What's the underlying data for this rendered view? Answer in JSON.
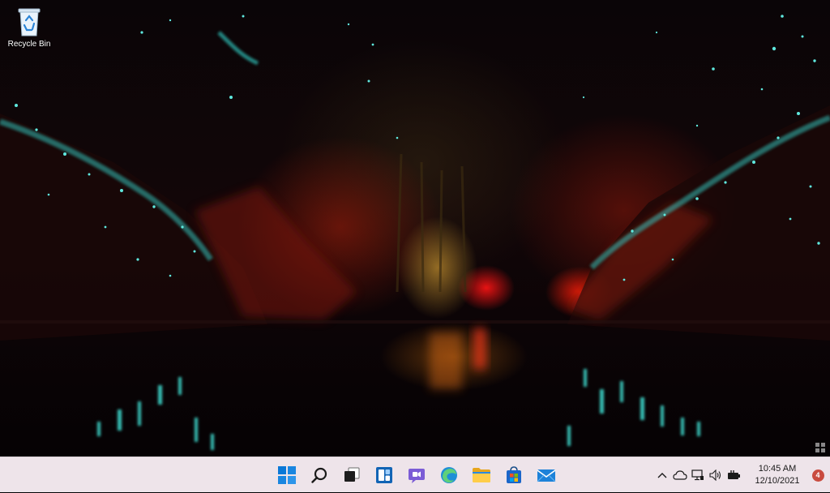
{
  "desktop": {
    "icons": [
      {
        "label": "Recycle Bin",
        "icon": "recycle-bin-icon"
      }
    ]
  },
  "taskbar": {
    "pinned": [
      {
        "name": "start",
        "icon": "windows-logo-icon"
      },
      {
        "name": "search",
        "icon": "search-icon"
      },
      {
        "name": "task-view",
        "icon": "task-view-icon"
      },
      {
        "name": "widgets",
        "icon": "widgets-icon"
      },
      {
        "name": "chat",
        "icon": "chat-icon"
      },
      {
        "name": "edge",
        "icon": "edge-icon"
      },
      {
        "name": "file-explorer",
        "icon": "folder-icon"
      },
      {
        "name": "store",
        "icon": "store-icon"
      },
      {
        "name": "mail",
        "icon": "mail-icon"
      }
    ],
    "tray": {
      "icons": [
        "chevron-up-icon",
        "onedrive-icon",
        "network-icon",
        "volume-icon",
        "battery-icon"
      ],
      "time": "10:45 AM",
      "date": "12/10/2021",
      "notification_count": "4"
    }
  },
  "colors": {
    "taskbar_bg": "#eee4ea",
    "accent_blue": "#0a78d7",
    "badge": "#c94b3f"
  }
}
